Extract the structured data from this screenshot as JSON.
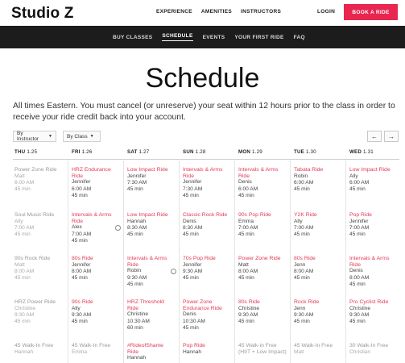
{
  "header": {
    "logo": "Studio Z",
    "nav": [
      "EXPERIENCE",
      "AMENITIES",
      "INSTRUCTORS"
    ],
    "login": "LOGIN",
    "book": "BOOK A RIDE",
    "accent": "#e8264f"
  },
  "subnav": {
    "items": [
      "BUY CLASSES",
      "SCHEDULE",
      "EVENTS",
      "YOUR FIRST RIDE",
      "FAQ"
    ],
    "active": "SCHEDULE"
  },
  "page": {
    "title": "Schedule",
    "intro": "All times Eastern. You must cancel (or unreserve) your seat within 12 hours prior to the class in order to receive your ride credit back into your account."
  },
  "filters": {
    "by_instructor": "By Instructor",
    "by_class": "By Class",
    "prev": "←",
    "next": "→"
  },
  "days": [
    {
      "label": "THU",
      "date": "1.25"
    },
    {
      "label": "FRI",
      "date": "1.26"
    },
    {
      "label": "SAT",
      "date": "1.27"
    },
    {
      "label": "SUN",
      "date": "1.28"
    },
    {
      "label": "MON",
      "date": "1.29"
    },
    {
      "label": "TUE",
      "date": "1.30"
    },
    {
      "label": "WED",
      "date": "1.31"
    }
  ],
  "schedule": [
    [
      {
        "name": "Power Zone Ride",
        "inst": "Matt",
        "time": "6:00 AM",
        "dur": "45 min",
        "past": true
      },
      {
        "name": "Soul Music Ride",
        "inst": "Ally",
        "time": "7:00 AM",
        "dur": "45 min",
        "past": true
      },
      {
        "name": "90s Rock Ride",
        "inst": "Matt",
        "time": "8:00 AM",
        "dur": "45 min",
        "past": true
      },
      {
        "name": "HRZ Power Ride",
        "inst": "Christine",
        "time": "9:30 AM",
        "dur": "45 min",
        "past": true
      },
      {
        "name": "45 Walk-In Free",
        "inst": "Hannah",
        "time": "",
        "dur": "",
        "past": true
      }
    ],
    [
      {
        "name": "HRZ Endurance Ride",
        "inst": "Jennifer",
        "time": "6:00 AM",
        "dur": "45 min",
        "past": false
      },
      {
        "name": "Intervals & Arms Ride",
        "inst": "Alex",
        "time": "7:00 AM",
        "dur": "45 min",
        "past": false,
        "dot": true
      },
      {
        "name": "80s Ride",
        "inst": "Jennifer",
        "time": "8:00 AM",
        "dur": "45 min",
        "past": false
      },
      {
        "name": "90s Ride",
        "inst": "Ally",
        "time": "9:30 AM",
        "dur": "45 min",
        "past": false
      },
      {
        "name": "45 Walk-In Free",
        "inst": "Emma",
        "time": "",
        "dur": "",
        "past": true
      }
    ],
    [
      {
        "name": "Low Impact Ride",
        "inst": "Jennifer",
        "time": "7:30 AM",
        "dur": "45 min",
        "past": false
      },
      {
        "name": "Low Impact Ride",
        "inst": "Hannah",
        "time": "8:30 AM",
        "dur": "45 min",
        "past": false
      },
      {
        "name": "Intervals & Arms Ride",
        "inst": "Robin",
        "time": "9:30 AM",
        "dur": "45 min",
        "past": false,
        "dot": true
      },
      {
        "name": "HRZ Threshold Ride",
        "inst": "Christine",
        "time": "10:30 AM",
        "dur": "60 min",
        "past": false
      },
      {
        "name": "#RideofShame Ride",
        "inst": "Hannah",
        "time": "",
        "dur": "",
        "past": false
      }
    ],
    [
      {
        "name": "Intervals & Arms Ride",
        "inst": "Jennifer",
        "time": "7:30 AM",
        "dur": "45 min",
        "past": false
      },
      {
        "name": "Classic Rock Ride",
        "inst": "Denis",
        "time": "8:30 AM",
        "dur": "45 min",
        "past": false
      },
      {
        "name": "70s Pop Ride",
        "inst": "Jennifer",
        "time": "9:30 AM",
        "dur": "45 min",
        "past": false
      },
      {
        "name": "Power Zone Endurance Ride",
        "inst": "Denis",
        "time": "10:30 AM",
        "dur": "45 min",
        "past": false
      },
      {
        "name": "Pop Ride",
        "inst": "Hannah",
        "time": "",
        "dur": "",
        "past": false
      }
    ],
    [
      {
        "name": "Intervals & Arms Ride",
        "inst": "Denis",
        "time": "6:00 AM",
        "dur": "45 min",
        "past": false
      },
      {
        "name": "90s Pop Ride",
        "inst": "Emma",
        "time": "7:00 AM",
        "dur": "45 min",
        "past": false
      },
      {
        "name": "Power Zone Ride",
        "inst": "Matt",
        "time": "8:00 AM",
        "dur": "45 min",
        "past": false
      },
      {
        "name": "80s Ride",
        "inst": "Christine",
        "time": "9:30 AM",
        "dur": "45 min",
        "past": false
      },
      {
        "name": "45 Walk-in Free (HIIT + Low Impact)",
        "inst": "",
        "time": "",
        "dur": "",
        "past": true
      }
    ],
    [
      {
        "name": "Tabata Ride",
        "inst": "Robin",
        "time": "6:00 AM",
        "dur": "45 min",
        "past": false
      },
      {
        "name": "Y2K Ride",
        "inst": "Ally",
        "time": "7:00 AM",
        "dur": "45 min",
        "past": false
      },
      {
        "name": "80s Ride",
        "inst": "Jenn",
        "time": "8:00 AM",
        "dur": "45 min",
        "past": false
      },
      {
        "name": "Rock Ride",
        "inst": "Jenn",
        "time": "9:30 AM",
        "dur": "45 min",
        "past": false
      },
      {
        "name": "45 Walk-In Free",
        "inst": "Matt",
        "time": "",
        "dur": "",
        "past": true
      }
    ],
    [
      {
        "name": "Low Impact Ride",
        "inst": "Ally",
        "time": "6:00 AM",
        "dur": "45 min",
        "past": false
      },
      {
        "name": "Pop Ride",
        "inst": "Jennifer",
        "time": "7:00 AM",
        "dur": "45 min",
        "past": false
      },
      {
        "name": "Intervals & Arms Ride",
        "inst": "Denis",
        "time": "8:00 AM",
        "dur": "45 min",
        "past": false
      },
      {
        "name": "Pro Cyclist Ride",
        "inst": "Christine",
        "time": "9:30 AM",
        "dur": "45 min",
        "past": false
      },
      {
        "name": "30 Walk-In Free",
        "inst": "Christian",
        "time": "",
        "dur": "",
        "past": true
      }
    ]
  ]
}
